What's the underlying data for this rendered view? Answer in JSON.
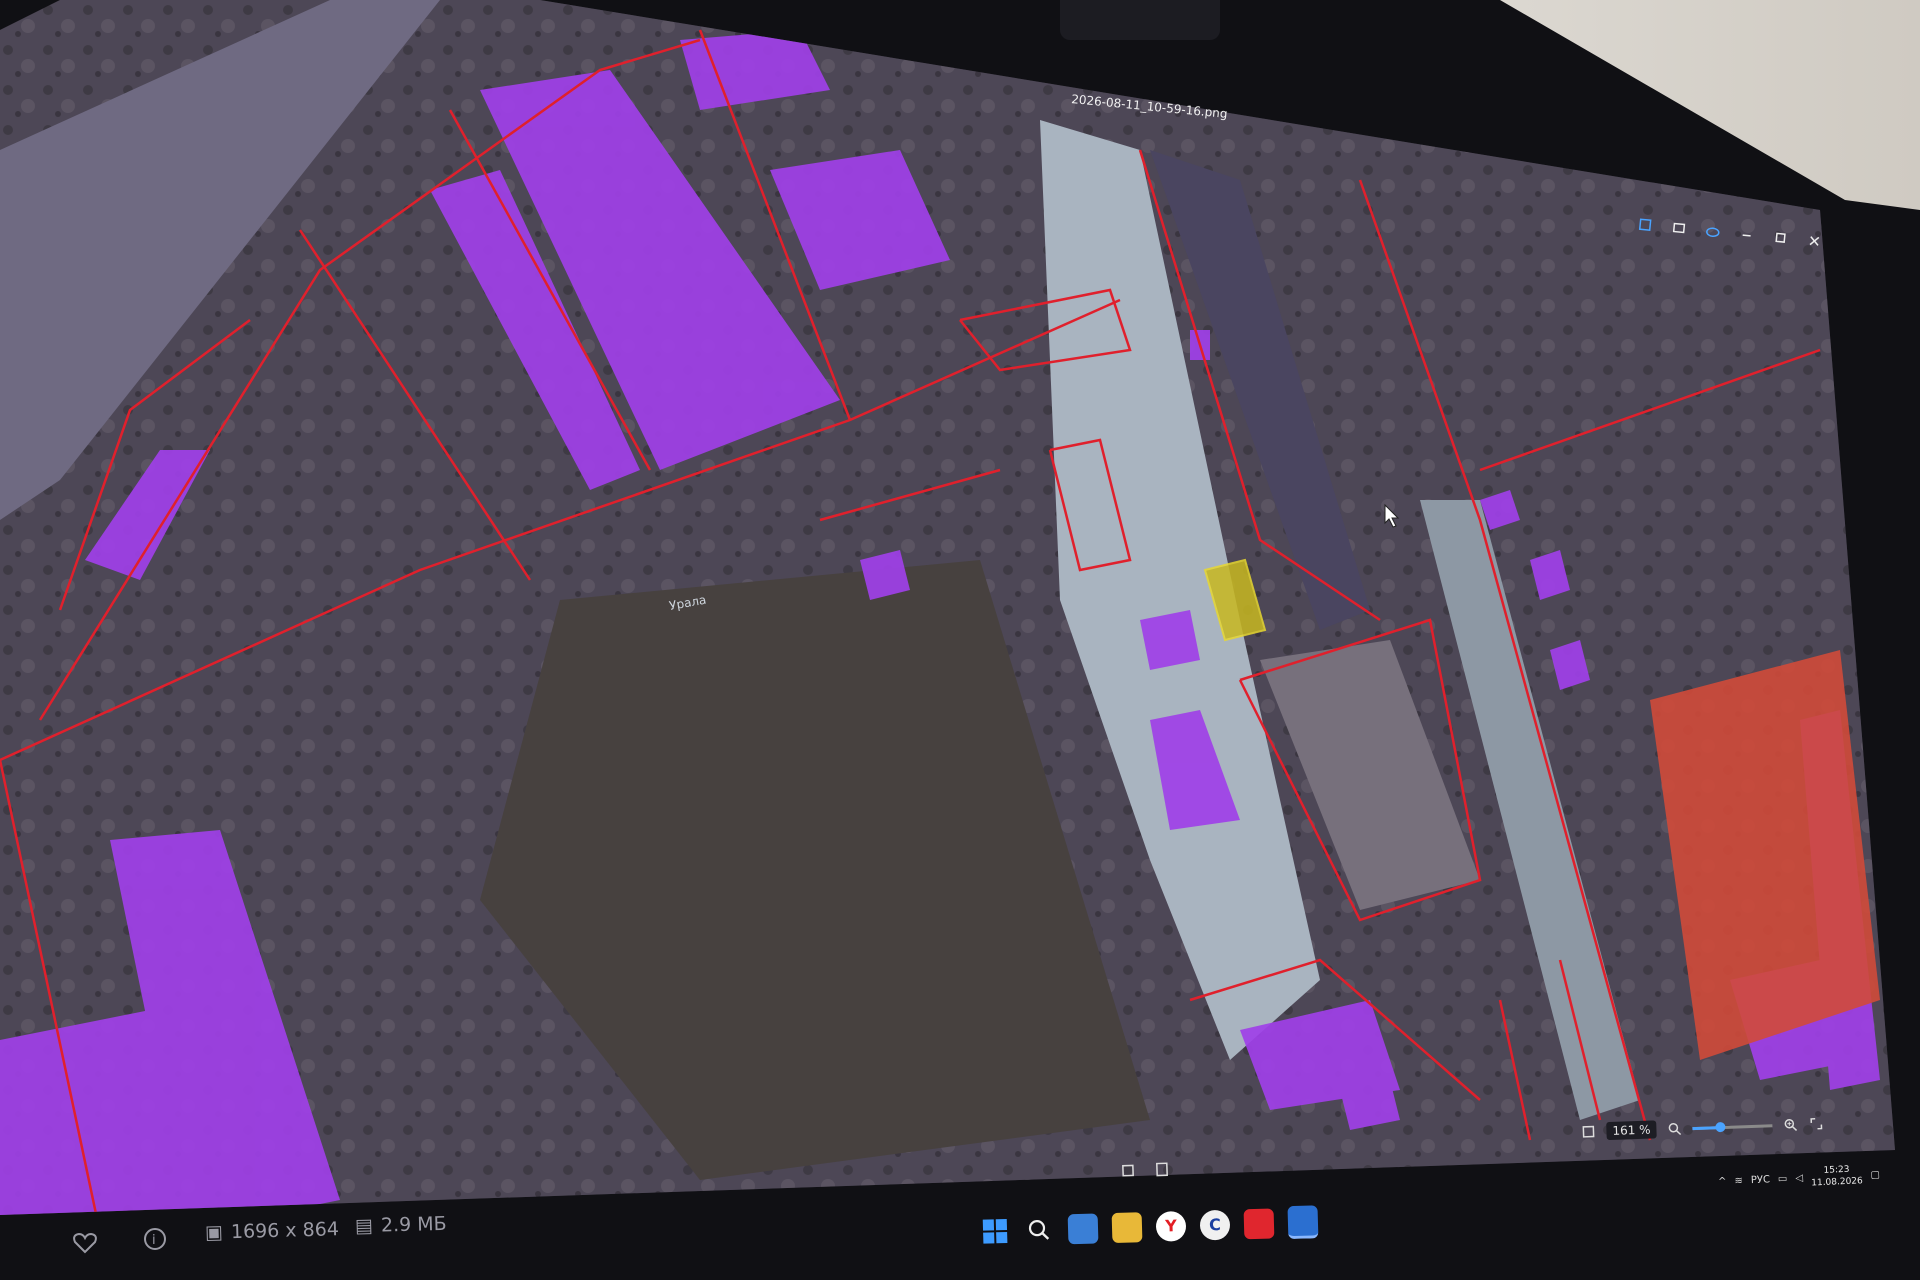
{
  "window": {
    "title": "2026-08-11_10-59-16.png",
    "controls": [
      "minimize",
      "maximize",
      "close"
    ]
  },
  "map": {
    "street_label": "Урала",
    "colors": {
      "parcel_border": "#e0202c",
      "building_fill": "#a040e8",
      "selected_fill": "#c8b820",
      "ground": "#5a5260",
      "road": "#9aa6b0",
      "roof_red": "#d04030"
    }
  },
  "viewer": {
    "zoom": "161 %",
    "zoom_level": 0.35
  },
  "info": {
    "dimensions": "1696 x 864",
    "size": "2.9 МБ"
  },
  "taskbar": {
    "apps": [
      "start-icon",
      "search-icon",
      "notes-icon",
      "folder-icon",
      "yandex-icon",
      "app-c-icon",
      "app-red-icon",
      "photos-icon"
    ],
    "yandex_label": "Y",
    "app_c_label": "C"
  },
  "tray": {
    "lang": "РУС",
    "time": "15:23",
    "date": "11.08.2026"
  }
}
